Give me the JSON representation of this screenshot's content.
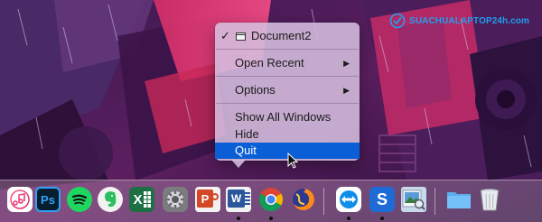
{
  "watermark": {
    "text": "SUACHUALAPTOP24h.com"
  },
  "context_menu": {
    "open_window": "Document2",
    "open_recent": "Open Recent",
    "options": "Options",
    "show_all_windows": "Show All Windows",
    "hide": "Hide",
    "quit": "Quit",
    "check_glyph": "✓",
    "submenu_arrow": "▶",
    "selected_item": "Quit"
  },
  "dock": {
    "apps": [
      {
        "name": "iTunes",
        "icon": "music-icon",
        "running": false
      },
      {
        "name": "Photoshop",
        "icon": "photoshop-icon",
        "label": "Ps",
        "running": false
      },
      {
        "name": "Spotify",
        "icon": "spotify-icon",
        "running": false
      },
      {
        "name": "Evernote",
        "icon": "evernote-icon",
        "running": false
      },
      {
        "name": "Excel",
        "icon": "excel-icon",
        "label": "X",
        "running": false
      },
      {
        "name": "System Preferences",
        "icon": "gear-icon",
        "running": false
      },
      {
        "name": "PowerPoint",
        "icon": "powerpoint-icon",
        "label": "P",
        "running": false
      },
      {
        "name": "Word",
        "icon": "word-icon",
        "label": "W",
        "running": true
      },
      {
        "name": "Chrome",
        "icon": "chrome-icon",
        "running": true
      },
      {
        "name": "Firefox",
        "icon": "firefox-icon",
        "running": false
      },
      {
        "name": "TeamViewer",
        "icon": "teamviewer-icon",
        "running": true
      },
      {
        "name": "Skitch",
        "icon": "skitch-icon",
        "label": "S",
        "running": true
      },
      {
        "name": "Preview",
        "icon": "preview-icon",
        "running": false
      },
      {
        "name": "Downloads",
        "icon": "folder-icon",
        "running": false
      },
      {
        "name": "Trash",
        "icon": "trash-icon",
        "running": false
      }
    ]
  },
  "colors": {
    "menu_bg": "#d4bede",
    "selection": "#0a5fd6",
    "watermark": "#1ea0f0"
  }
}
